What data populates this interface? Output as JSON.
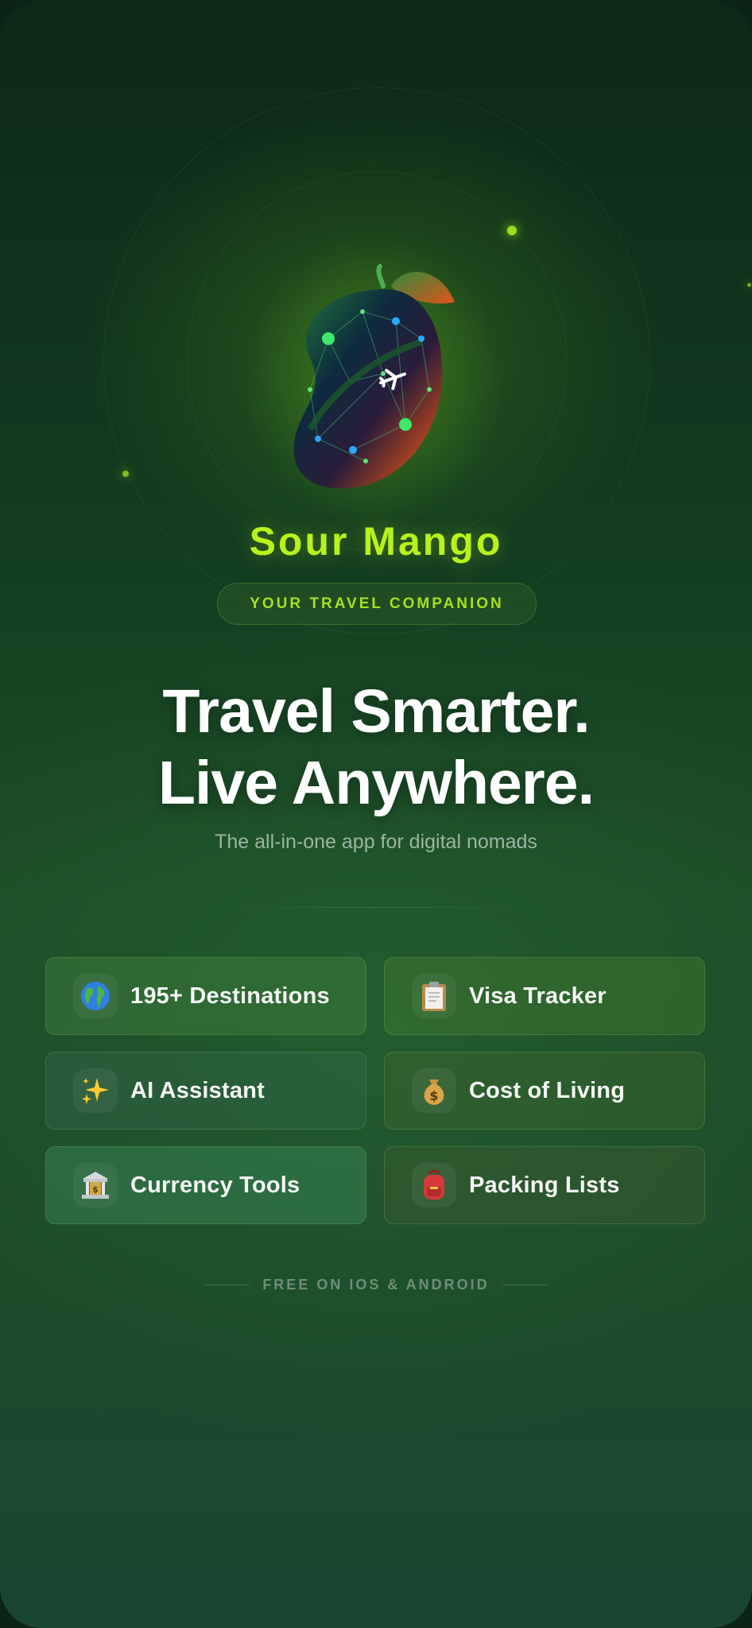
{
  "app": {
    "name": "Sour Mango",
    "tagline": "YOUR TRAVEL COMPANION",
    "logo_icon": "mango-globe-icon",
    "accent_color": "#b8f21a"
  },
  "hero": {
    "headline_line1": "Travel Smarter.",
    "headline_line2": "Live Anywhere.",
    "subtitle": "The all-in-one app for digital nomads"
  },
  "features": [
    {
      "label": "195+ Destinations",
      "icon": "globe-icon",
      "glyph": "🌍"
    },
    {
      "label": "Visa Tracker",
      "icon": "clipboard-icon",
      "glyph": "📋"
    },
    {
      "label": "AI Assistant",
      "icon": "sparkles-icon",
      "glyph": "✨"
    },
    {
      "label": "Cost of Living",
      "icon": "money-bag-icon",
      "glyph": "💰"
    },
    {
      "label": "Currency Tools",
      "icon": "bank-icon",
      "glyph": "🏦"
    },
    {
      "label": "Packing Lists",
      "icon": "backpack-icon",
      "glyph": "🎒"
    }
  ],
  "footer": {
    "availability": "FREE ON IOS & ANDROID"
  }
}
